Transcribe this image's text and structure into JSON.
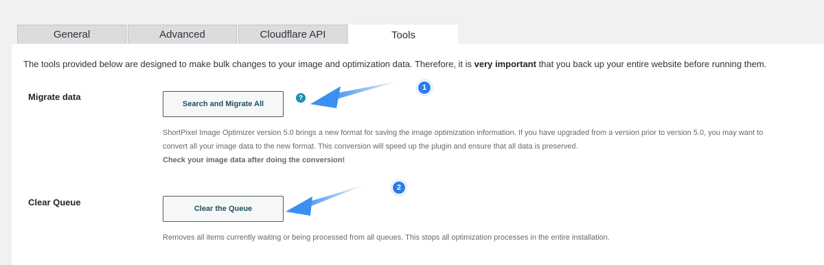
{
  "tabs": [
    {
      "label": "General"
    },
    {
      "label": "Advanced"
    },
    {
      "label": "Cloudflare API"
    },
    {
      "label": "Tools"
    }
  ],
  "active_tab": "Tools",
  "intro": {
    "before": "The tools provided below are designed to make bulk changes to your image and optimization data. Therefore, it is ",
    "emphasis": "very important",
    "after": " that you back up your entire website before running them."
  },
  "migrate": {
    "label": "Migrate data",
    "button": "Search and Migrate All",
    "help_icon": "?",
    "description_line1": "ShortPixel Image Optimizer version 5.0 brings a new format for saving the image optimization information. If you have upgraded from a version prior to version 5.0, you may want to",
    "description_line2": "convert all your image data to the new format. This conversion will speed up the plugin and ensure that all data is preserved.",
    "description_bold": "Check your image data after doing the conversion!",
    "badge": "1"
  },
  "queue": {
    "label": "Clear Queue",
    "button": "Clear the Queue",
    "description": "Removes all items currently waiting or being processed from all queues. This stops all optimization processes in the entire installation.",
    "badge": "2"
  },
  "colors": {
    "accent_arrow": "#3b8ff0",
    "badge": "#2b7de9",
    "help_icon": "#1f8eb3"
  },
  "icons": {
    "help": "help-icon",
    "annotation_arrow": "arrow-icon"
  }
}
